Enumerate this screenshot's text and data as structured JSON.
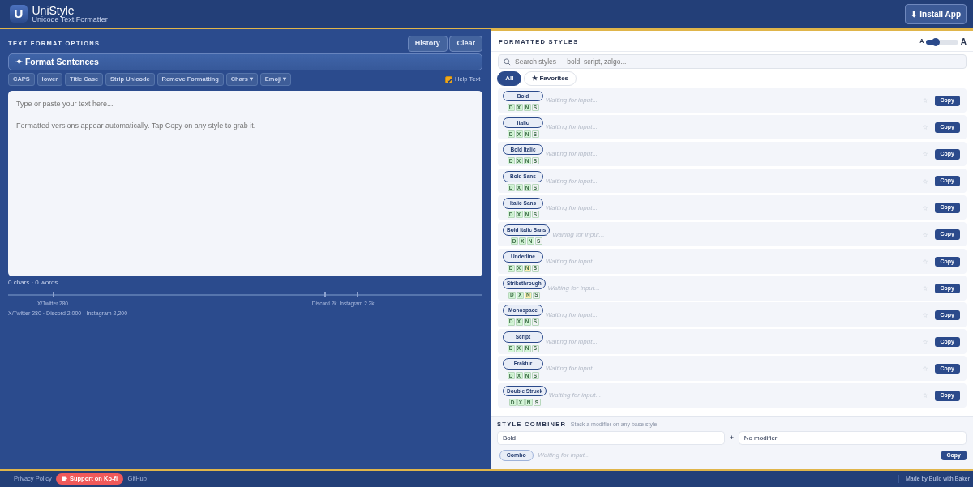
{
  "header": {
    "logo": "U",
    "title": "UniStyle",
    "subtitle": "Unicode Text Formatter",
    "install_button": "⬇ Install App"
  },
  "left": {
    "title": "TEXT FORMAT OPTIONS",
    "actions": [
      "History",
      "Clear"
    ],
    "format_button": "✦ Format Sentences",
    "tools": [
      {
        "label": "CAPS",
        "kind": "button"
      },
      {
        "label": "lower",
        "kind": "button"
      },
      {
        "label": "Title Case",
        "kind": "button"
      },
      {
        "label": "Strip Unicode",
        "kind": "button"
      },
      {
        "label": "Remove Formatting",
        "kind": "button"
      },
      {
        "label": "Chars",
        "kind": "dropdown",
        "caret": "▾"
      },
      {
        "label": "Emoji",
        "kind": "dropdown",
        "caret": "▾"
      }
    ],
    "help_text": {
      "label": "Help Text",
      "checked": true
    },
    "editor": {
      "placeholder": "Type or paste your text here...\n\nFormatted versions appear automatically. Tap Copy on any style to grab it."
    },
    "counter": "0 chars · 0 words",
    "limits": [
      {
        "label": "X/Twitter 280",
        "level": 0.094
      },
      {
        "label": "Discord 2k",
        "level": 0.667
      },
      {
        "label": "Instagram 2.2k",
        "level": 0.735
      }
    ],
    "limits_text": "X/Twitter 280 · Discord 2,000 · Instagram 2,200"
  },
  "right": {
    "title": "FORMATTED STYLES",
    "size_small": "A",
    "size_large": "A",
    "size_slider": {
      "level": 0.3
    },
    "search": {
      "placeholder": "Search styles — bold, script, zalgo..."
    },
    "filters": [
      {
        "label": "All",
        "selected": true
      },
      {
        "label": "★ Favorites",
        "selected": false
      }
    ],
    "styles": [
      {
        "name": "Bold",
        "output": "Waiting for input...",
        "copy": "Copy",
        "badges": [
          {
            "label": "D",
            "color": "#d3f5d6"
          },
          {
            "label": "X",
            "color": "#d3f5d6"
          },
          {
            "label": "N",
            "color": "#d3f5d6"
          },
          {
            "label": "S",
            "color": "#f1f2f4"
          }
        ]
      },
      {
        "name": "Italic",
        "output": "Waiting for input...",
        "copy": "Copy",
        "badges": [
          {
            "label": "D",
            "color": "#d3f5d6"
          },
          {
            "label": "X",
            "color": "#d3f5d6"
          },
          {
            "label": "N",
            "color": "#d3f5d6"
          },
          {
            "label": "S",
            "color": "#f1f2f4"
          }
        ]
      },
      {
        "name": "Bold Italic",
        "output": "Waiting for input...",
        "copy": "Copy",
        "badges": [
          {
            "label": "D",
            "color": "#d3f5d6"
          },
          {
            "label": "X",
            "color": "#d3f5d6"
          },
          {
            "label": "N",
            "color": "#d3f5d6"
          },
          {
            "label": "S",
            "color": "#f1f2f4"
          }
        ]
      },
      {
        "name": "Bold Sans",
        "output": "Waiting for input...",
        "copy": "Copy",
        "badges": [
          {
            "label": "D",
            "color": "#d3f5d6"
          },
          {
            "label": "X",
            "color": "#d3f5d6"
          },
          {
            "label": "N",
            "color": "#d3f5d6"
          },
          {
            "label": "S",
            "color": "#f1f2f4"
          }
        ]
      },
      {
        "name": "Italic Sans",
        "output": "Waiting for input...",
        "copy": "Copy",
        "badges": [
          {
            "label": "D",
            "color": "#d3f5d6"
          },
          {
            "label": "X",
            "color": "#d3f5d6"
          },
          {
            "label": "N",
            "color": "#d3f5d6"
          },
          {
            "label": "S",
            "color": "#f1f2f4"
          }
        ]
      },
      {
        "name": "Bold Italic Sans",
        "output": "Waiting for input...",
        "copy": "Copy",
        "badges": [
          {
            "label": "D",
            "color": "#d3f5d6"
          },
          {
            "label": "X",
            "color": "#d3f5d6"
          },
          {
            "label": "N",
            "color": "#d3f5d6"
          },
          {
            "label": "S",
            "color": "#f1f2f4"
          }
        ]
      },
      {
        "name": "Underline",
        "output": "Waiting for input...",
        "copy": "Copy",
        "badges": [
          {
            "label": "D",
            "color": "#d3f5d6"
          },
          {
            "label": "X",
            "color": "#d3f5d6"
          },
          {
            "label": "N",
            "color": "#fdf0b0"
          },
          {
            "label": "S",
            "color": "#f1f2f4"
          }
        ]
      },
      {
        "name": "Strikethrough",
        "output": "Waiting for input...",
        "copy": "Copy",
        "badges": [
          {
            "label": "D",
            "color": "#d3f5d6"
          },
          {
            "label": "X",
            "color": "#d3f5d6"
          },
          {
            "label": "N",
            "color": "#fdf0b0"
          },
          {
            "label": "S",
            "color": "#f1f2f4"
          }
        ]
      },
      {
        "name": "Monospace",
        "output": "Waiting for input...",
        "copy": "Copy",
        "badges": [
          {
            "label": "D",
            "color": "#d3f5d6"
          },
          {
            "label": "X",
            "color": "#d3f5d6"
          },
          {
            "label": "N",
            "color": "#d3f5d6"
          },
          {
            "label": "S",
            "color": "#f1f2f4"
          }
        ]
      },
      {
        "name": "Script",
        "output": "Waiting for input...",
        "copy": "Copy",
        "badges": [
          {
            "label": "D",
            "color": "#d3f5d6"
          },
          {
            "label": "X",
            "color": "#d3f5d6"
          },
          {
            "label": "N",
            "color": "#d3f5d6"
          },
          {
            "label": "S",
            "color": "#f1f2f4"
          }
        ]
      },
      {
        "name": "Fraktur",
        "output": "Waiting for input...",
        "copy": "Copy",
        "badges": [
          {
            "label": "D",
            "color": "#d3f5d6"
          },
          {
            "label": "X",
            "color": "#d3f5d6"
          },
          {
            "label": "N",
            "color": "#d3f5d6"
          },
          {
            "label": "S",
            "color": "#f1f2f4"
          }
        ]
      },
      {
        "name": "Double Struck",
        "output": "Waiting for input...",
        "copy": "Copy",
        "badges": [
          {
            "label": "D",
            "color": "#d3f5d6"
          },
          {
            "label": "X",
            "color": "#d3f5d6"
          },
          {
            "label": "N",
            "color": "#d3f5d6"
          },
          {
            "label": "S",
            "color": "#f1f2f4"
          }
        ]
      }
    ],
    "combiner": {
      "title": "STYLE COMBINER",
      "hint": "Stack a modifier on any base style",
      "base": "Bold",
      "plus": "+",
      "modifier": "No modifier",
      "tag": "Combo",
      "output": "Waiting for input...",
      "copy": "Copy"
    }
  },
  "footer": {
    "links": [
      {
        "label": "Privacy Policy",
        "kind": "link"
      },
      {
        "label": "Support on Ko-fi",
        "kind": "donate"
      },
      {
        "label": "GitHub",
        "kind": "link"
      }
    ],
    "credit": "Made by Build with Baker"
  }
}
